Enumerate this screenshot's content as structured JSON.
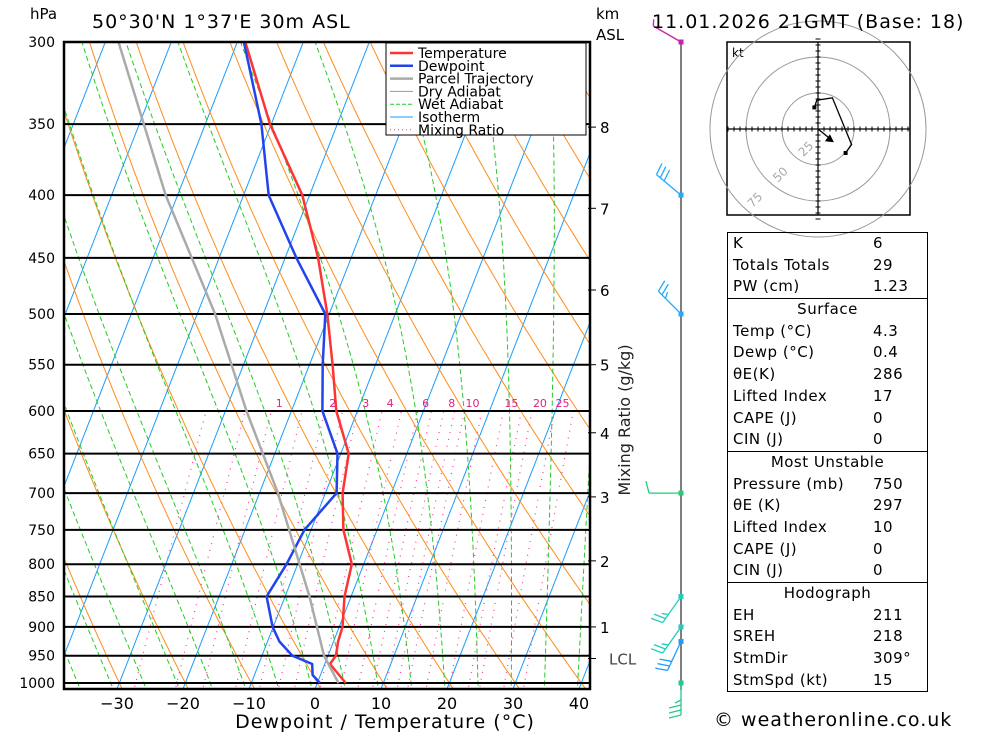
{
  "header": {
    "pressure_unit": "hPa",
    "location": "50°30'N  1°37'E  30m  ASL",
    "height_unit": "km",
    "height_ref": "ASL",
    "datetime": "11.01.2026  21GMT  (Base: 18)"
  },
  "legend": [
    {
      "label": "Temperature",
      "color": "#ff3333"
    },
    {
      "label": "Dewpoint",
      "color": "#2244ee"
    },
    {
      "label": "Parcel Trajectory",
      "color": "#aaaaaa"
    },
    {
      "label": "Dry Adiabat",
      "color": "#999999"
    },
    {
      "label": "Wet Adiabat",
      "color": "#22cc22"
    },
    {
      "label": "Isotherm",
      "color": "#1a9cff"
    },
    {
      "label": "Mixing Ratio",
      "color": "#ff3399"
    }
  ],
  "colors": {
    "temperature": "#ff3333",
    "dewpoint": "#2244ee",
    "parcel": "#aaaaaa",
    "dry_adiabat": "#ff8c1a",
    "wet_adiabat": "#22cc22",
    "isotherm": "#1a9cff",
    "mixing_ratio": "#ff3399"
  },
  "chart_data": {
    "type": "line",
    "subtype": "skew-T log-p",
    "xlabel": "Dewpoint / Temperature (°C)",
    "ylabel": "hPa",
    "secondary_label": "Mixing Ratio (g/kg)",
    "xlim": [
      -40,
      40
    ],
    "ylim": [
      1000,
      300
    ],
    "y_scale": "log",
    "x_ticks": [
      -30,
      -20,
      -10,
      0,
      10,
      20,
      30,
      40
    ],
    "pressure_levels": [
      300,
      350,
      400,
      450,
      500,
      550,
      600,
      650,
      700,
      750,
      800,
      850,
      900,
      950,
      1000
    ],
    "height_km_ticks": [
      {
        "label": "8",
        "p": 352
      },
      {
        "label": "7",
        "p": 410
      },
      {
        "label": "6",
        "p": 478
      },
      {
        "label": "5",
        "p": 550
      },
      {
        "label": "4",
        "p": 625
      },
      {
        "label": "3",
        "p": 705
      },
      {
        "label": "2",
        "p": 795
      },
      {
        "label": "1",
        "p": 900
      },
      {
        "label": "LCL",
        "p": 955
      }
    ],
    "mixing_ratio_labels": [
      1,
      2,
      3,
      4,
      6,
      8,
      10,
      15,
      20,
      25
    ],
    "series": [
      {
        "name": "Temperature",
        "p": [
          1000,
          965,
          950,
          925,
          900,
          850,
          800,
          750,
          700,
          650,
          600,
          550,
          500,
          450,
          400,
          350,
          300
        ],
        "t": [
          4.3,
          0.8,
          1.2,
          0.7,
          0.5,
          -1.0,
          -1.8,
          -5.1,
          -7.4,
          -8.8,
          -13.2,
          -16.5,
          -20.3,
          -25.0,
          -31.1,
          -40.2,
          -48.8
        ]
      },
      {
        "name": "Dewpoint",
        "p": [
          1000,
          985,
          965,
          950,
          925,
          900,
          850,
          800,
          750,
          700,
          650,
          600,
          550,
          500,
          450,
          400,
          350,
          300
        ],
        "t": [
          0.4,
          -1.2,
          -1.9,
          -5.4,
          -8.2,
          -10.1,
          -12.8,
          -11.7,
          -11.0,
          -8.3,
          -10.5,
          -15.3,
          -18.0,
          -20.6,
          -28.3,
          -36.2,
          -41.5,
          -49.0
        ]
      },
      {
        "name": "Parcel Trajectory",
        "p": [
          1000,
          950,
          850,
          700,
          600,
          500,
          400,
          300
        ],
        "t": [
          3.2,
          -0.6,
          -6.3,
          -17.2,
          -26.8,
          -37.3,
          -51.8,
          -68.0
        ]
      }
    ],
    "winds": [
      {
        "p": 300,
        "dir": 300,
        "kt": 5,
        "color": "#cc22aa"
      },
      {
        "p": 400,
        "dir": 310,
        "kt": 30,
        "color": "#22aaff"
      },
      {
        "p": 500,
        "dir": 315,
        "kt": 25,
        "color": "#22aaff"
      },
      {
        "p": 700,
        "dir": 270,
        "kt": 10,
        "color": "#22cc77"
      },
      {
        "p": 850,
        "dir": 215,
        "kt": 25,
        "color": "#22ccbb"
      },
      {
        "p": 900,
        "dir": 215,
        "kt": 25,
        "color": "#22ccbb"
      },
      {
        "p": 925,
        "dir": 205,
        "kt": 30,
        "color": "#2299ff"
      },
      {
        "p": 1000,
        "dir": 180,
        "kt": 35,
        "color": "#22cc88"
      }
    ]
  },
  "hodograph": {
    "unit": "kt",
    "rings": [
      25,
      50,
      75
    ],
    "points_uv": [
      [
        -3,
        18
      ],
      [
        -1,
        24
      ],
      [
        12,
        26
      ],
      [
        28,
        -13
      ],
      [
        23,
        -20
      ]
    ],
    "storm_motion_uv": [
      11.6,
      -9.4
    ]
  },
  "indices": [
    {
      "title": "",
      "rows": [
        [
          "K",
          "6"
        ],
        [
          "Totals Totals",
          "29"
        ],
        [
          "PW (cm)",
          "1.23"
        ]
      ]
    },
    {
      "title": "Surface",
      "rows": [
        [
          "Temp (°C)",
          "4.3"
        ],
        [
          "Dewp (°C)",
          "0.4"
        ],
        [
          "θE(K)",
          "286"
        ],
        [
          "Lifted Index",
          "17"
        ],
        [
          "CAPE (J)",
          "0"
        ],
        [
          "CIN (J)",
          "0"
        ]
      ]
    },
    {
      "title": "Most Unstable",
      "rows": [
        [
          "Pressure (mb)",
          "750"
        ],
        [
          "θE (K)",
          "297"
        ],
        [
          "Lifted Index",
          "10"
        ],
        [
          "CAPE (J)",
          "0"
        ],
        [
          "CIN (J)",
          "0"
        ]
      ]
    },
    {
      "title": "Hodograph",
      "rows": [
        [
          "EH",
          "211"
        ],
        [
          "SREH",
          "218"
        ],
        [
          "StmDir",
          "309°"
        ],
        [
          "StmSpd (kt)",
          "15"
        ]
      ]
    }
  ],
  "copyright": "© weatheronline.co.uk"
}
